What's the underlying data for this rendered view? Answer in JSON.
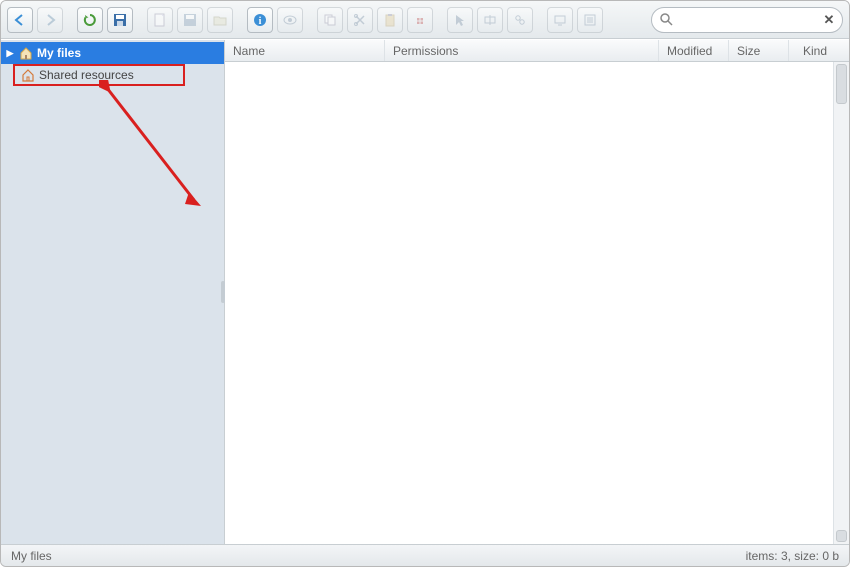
{
  "search": {
    "placeholder": ""
  },
  "sidebar": {
    "items": [
      {
        "label": "My files"
      },
      {
        "label": "Shared resources"
      }
    ]
  },
  "columns": {
    "name": "Name",
    "permissions": "Permissions",
    "modified": "Modified",
    "size": "Size",
    "kind": "Kind"
  },
  "status": {
    "path": "My files",
    "summary": "items: 3, size: 0 b"
  }
}
